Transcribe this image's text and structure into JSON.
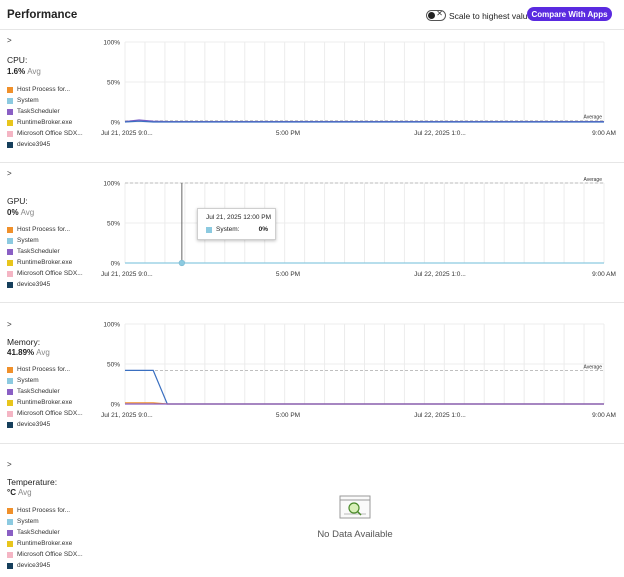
{
  "header": {
    "title": "Performance",
    "toggle_label": "Scale to highest value",
    "compare_button": "Compare With Apps"
  },
  "legend": [
    {
      "label": "Host Process for...",
      "color": "#f0902a"
    },
    {
      "label": "System",
      "color": "#8ccae0"
    },
    {
      "label": "TaskScheduler",
      "color": "#8a5fc4"
    },
    {
      "label": "RuntimeBroker.exe",
      "color": "#e8c51c"
    },
    {
      "label": "Microsoft Office SDX...",
      "color": "#f4b5c4"
    },
    {
      "label": "device3945",
      "color": "#163f5c"
    }
  ],
  "panels": [
    {
      "expand": ">",
      "title": "CPU:",
      "value": "1.6%",
      "value_suffix": "Avg",
      "chart_data": {
        "type": "line",
        "y_ticks": [
          "100%",
          "50%",
          "0%"
        ],
        "ylim": [
          0,
          100
        ],
        "x_ticks": [
          "Jul 21, 2025 9:0...",
          "5:00 PM",
          "Jul 22, 2025 1:0...",
          "9:00 AM"
        ],
        "average_label": "Average",
        "average": 1.6,
        "series": [
          {
            "color": "#7b5cc7",
            "values": [
              0.5,
              2.5,
              1,
              0.5,
              0.5,
              0.5,
              0.5,
              0.5,
              0.5,
              0.5,
              0.5,
              0.5,
              0.5,
              0.5,
              0.5,
              0.5,
              0.5,
              0.5,
              0.5,
              0.5,
              0.5,
              0.5,
              0.5,
              0.5,
              0.5,
              0.5,
              0.5,
              0.5,
              0.5,
              0.5,
              0.5,
              0.5,
              0.5,
              0.5,
              0.5
            ]
          },
          {
            "color": "#3a6fc0",
            "values": [
              0,
              1,
              0,
              0,
              0,
              0,
              0,
              0,
              0,
              0,
              0,
              0,
              0,
              0,
              0,
              0,
              0,
              0,
              0,
              0,
              0,
              0,
              0,
              0,
              0,
              0,
              0,
              0,
              0,
              0,
              0,
              0,
              0,
              0,
              0
            ]
          }
        ]
      }
    },
    {
      "expand": ">",
      "title": "GPU:",
      "value": "0%",
      "value_suffix": "Avg",
      "chart_data": {
        "type": "line",
        "y_ticks": [
          "100%",
          "50%",
          "0%"
        ],
        "ylim": [
          0,
          100
        ],
        "x_ticks": [
          "Jul 21, 2025 9:0...",
          "5:00 PM",
          "Jul 22, 2025 1:0...",
          "9:00 AM"
        ],
        "average_label": "Average",
        "average": 100,
        "series": [
          {
            "color": "#8ccae0",
            "values": [
              0,
              0,
              0,
              0,
              0,
              0,
              0,
              0,
              0,
              0,
              0,
              0,
              0,
              0,
              0,
              0,
              0,
              0,
              0,
              0,
              0,
              0,
              0,
              0,
              0,
              0,
              0,
              0,
              0,
              0,
              0,
              0,
              0,
              0,
              0
            ]
          }
        ],
        "hover_index": 4,
        "tooltip": {
          "date": "Jul 21, 2025 12:00 PM",
          "series": "System:",
          "value": "0%",
          "color": "#8ccae0"
        }
      }
    },
    {
      "expand": ">",
      "title": "Memory:",
      "value": "41.89%",
      "value_suffix": "Avg",
      "chart_data": {
        "type": "line",
        "y_ticks": [
          "100%",
          "50%",
          "0%"
        ],
        "ylim": [
          0,
          100
        ],
        "x_ticks": [
          "Jul 21, 2025 9:0...",
          "5:00 PM",
          "Jul 22, 2025 1:0...",
          "9:00 AM"
        ],
        "average_label": "Average",
        "average": 41.89,
        "series": [
          {
            "color": "#3a6fc0",
            "values": [
              42,
              42,
              42,
              0,
              0,
              0,
              0,
              0,
              0,
              0,
              0,
              0,
              0,
              0,
              0,
              0,
              0,
              0,
              0,
              0,
              0,
              0,
              0,
              0,
              0,
              0,
              0,
              0,
              0,
              0,
              0,
              0,
              0,
              0,
              0
            ]
          },
          {
            "color": "#f0902a",
            "values": [
              1.5,
              1.5,
              1.5,
              0,
              0,
              0,
              0,
              0,
              0,
              0,
              0,
              0,
              0,
              0,
              0,
              0,
              0,
              0,
              0,
              0,
              0,
              0,
              0,
              0,
              0,
              0,
              0,
              0,
              0,
              0,
              0,
              0,
              0,
              0,
              0
            ]
          },
          {
            "color": "#8a5fc4",
            "values": [
              0,
              0,
              0,
              0,
              0,
              0,
              0,
              0,
              0,
              0,
              0,
              0,
              0,
              0,
              0,
              0,
              0,
              0,
              0,
              0,
              0,
              0,
              0,
              0,
              0,
              0,
              0,
              0,
              0,
              0,
              0,
              0,
              0,
              0,
              0
            ]
          }
        ]
      }
    },
    {
      "expand": ">",
      "title": "Temperature:",
      "value": "°C",
      "value_suffix": "Avg",
      "no_data": "No Data Available"
    }
  ]
}
